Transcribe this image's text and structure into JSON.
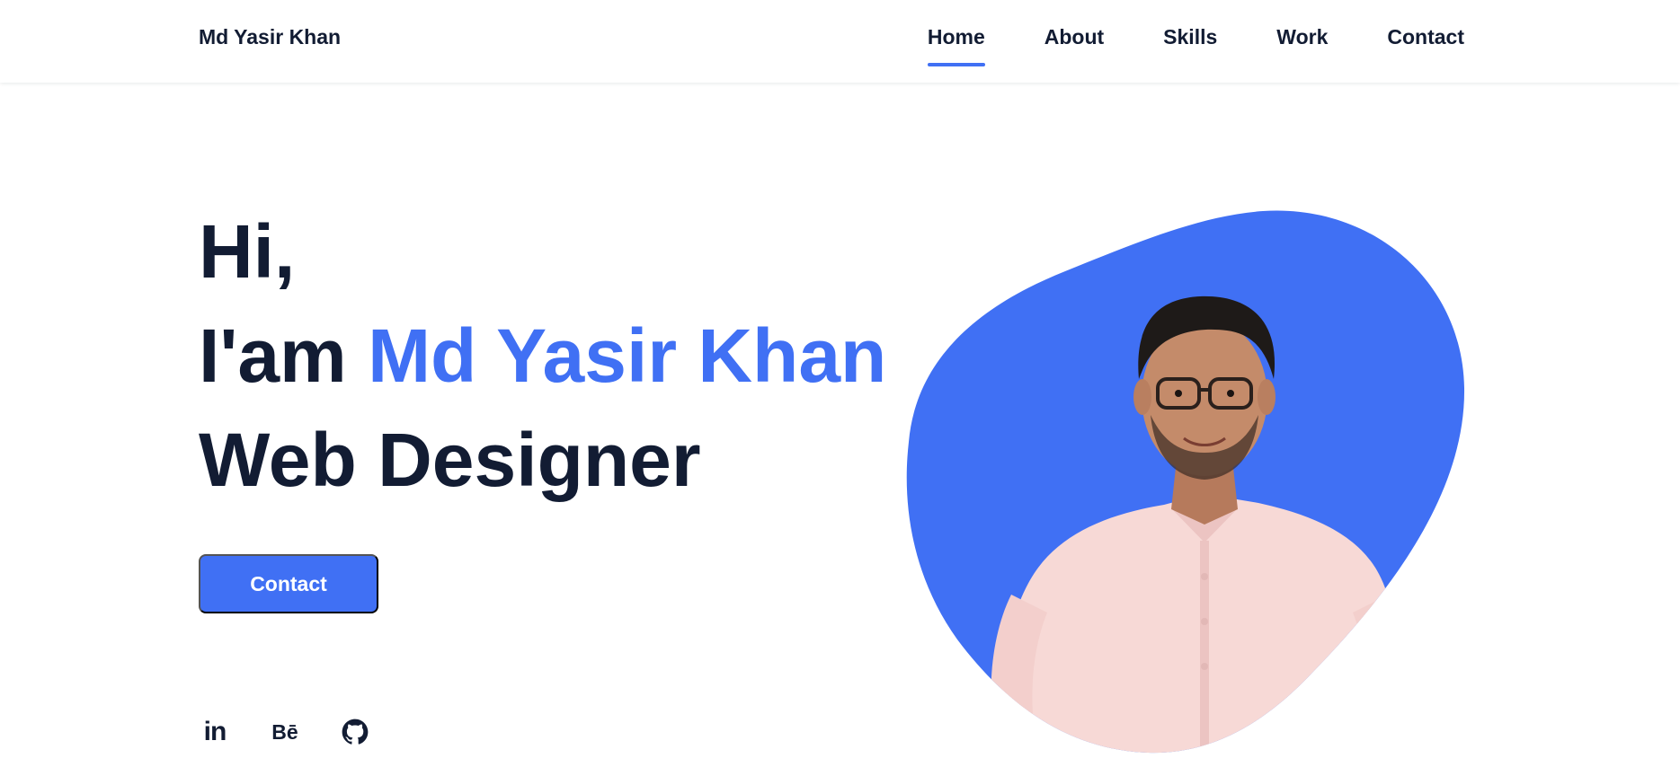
{
  "header": {
    "logo": "Md Yasir Khan",
    "nav": [
      {
        "label": "Home",
        "active": true
      },
      {
        "label": "About",
        "active": false
      },
      {
        "label": "Skills",
        "active": false
      },
      {
        "label": "Work",
        "active": false
      },
      {
        "label": "Contact",
        "active": false
      }
    ]
  },
  "hero": {
    "greeting": "Hi,",
    "intro_prefix": "I'am",
    "name": "Md Yasir Khan",
    "role": "Web Designer",
    "button_label": "Contact"
  },
  "social": {
    "linkedin": "in",
    "behance": "Bē",
    "github_icon": "github-icon"
  },
  "colors": {
    "accent": "#4070f4",
    "title": "#121c33",
    "background": "#ffffff"
  },
  "image": {
    "alt": "portrait-photo"
  }
}
